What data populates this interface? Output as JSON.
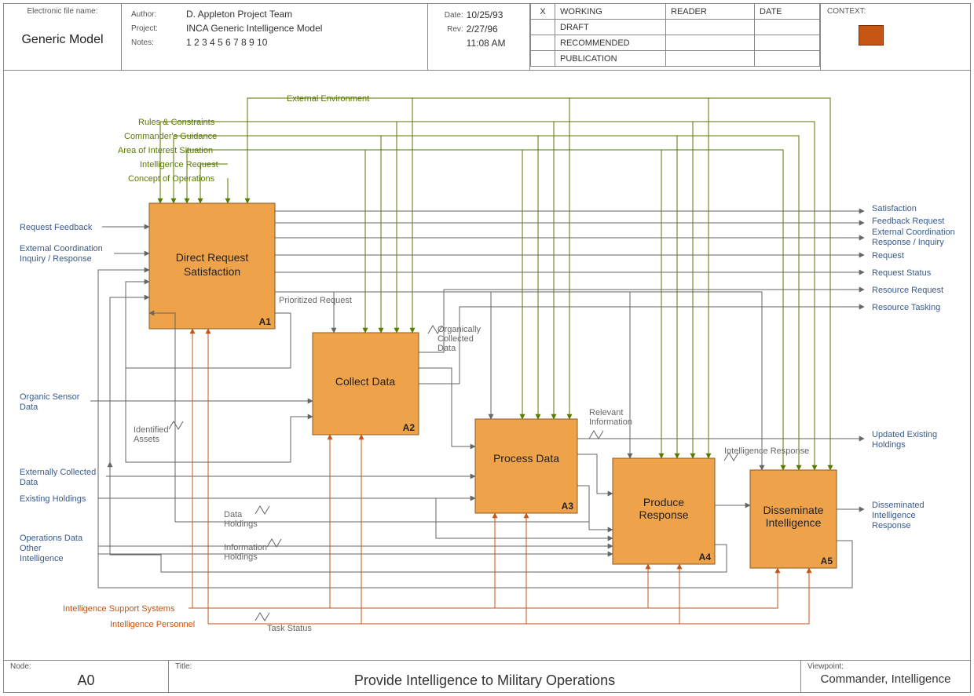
{
  "header": {
    "efname_lbl": "Electronic file name:",
    "efname": "Generic Model",
    "author_lbl": "Author:",
    "author": "D. Appleton Project Team",
    "project_lbl": "Project:",
    "project": "INCA Generic Intelligence Model",
    "notes_lbl": "Notes:",
    "notes": "1  2  3  4  5  6  7  8  9  10",
    "date_lbl": "Date:",
    "date": "10/25/93",
    "rev_lbl": "Rev:",
    "rev": "2/27/96",
    "rev_time": "11:08 AM",
    "status_x": "X",
    "status_rows": [
      "WORKING",
      "DRAFT",
      "RECOMMENDED",
      "PUBLICATION"
    ],
    "reader_lbl": "READER",
    "rdate_lbl": "DATE",
    "context_lbl": "CONTEXT:"
  },
  "footer": {
    "node_lbl": "Node:",
    "node": "A0",
    "title_lbl": "Title:",
    "title": "Provide Intelligence to Military Operations",
    "vp_lbl": "Viewpoint:",
    "vp": "Commander, Intelligence"
  },
  "activities": {
    "a1": {
      "name_l1": "Direct Request",
      "name_l2": "Satisfaction",
      "id": "A1"
    },
    "a2": {
      "name_l1": "Collect Data",
      "name_l2": "",
      "id": "A2"
    },
    "a3": {
      "name_l1": "Process Data",
      "name_l2": "",
      "id": "A3"
    },
    "a4": {
      "name_l1": "Produce",
      "name_l2": "Response",
      "id": "A4"
    },
    "a5": {
      "name_l1": "Disseminate",
      "name_l2": "Intelligence",
      "id": "A5"
    }
  },
  "controls": {
    "ext_env": "External Environment",
    "rules": "Rules & Constraints",
    "guidance": "Commander's Guidance",
    "aoi": "Area of Interest Situation",
    "intreq": "Intelligence Request",
    "conops": "Concept of Operations"
  },
  "inputs_left": {
    "reqfb": "Request Feedback",
    "extcoord_l1": "External Coordination",
    "extcoord_l2": "Inquiry / Response",
    "osd_l1": "Organic Sensor",
    "osd_l2": "Data",
    "extcol_l1": "Externally Collected",
    "extcol_l2": "Data",
    "existhold": "Existing Holdings",
    "opdata": "Operations Data",
    "otherint_l1": "Other",
    "otherint_l2": "Intelligence"
  },
  "outputs_right": {
    "sat": "Satisfaction",
    "fbreq": "Feedback Request",
    "extcoord_r1": "External Coordination",
    "extcoord_r2": "Response / Inquiry",
    "req": "Request",
    "reqstat": "Request Status",
    "resreq": "Resource Request",
    "restask": "Resource Tasking",
    "updhold_l1": "Updated Existing",
    "updhold_l2": "Holdings",
    "dissem_l1": "Disseminated",
    "dissem_l2": "Intelligence",
    "dissem_l3": "Response"
  },
  "mechanisms": {
    "iss": "Intelligence Support Systems",
    "ip": "Intelligence Personnel"
  },
  "internal": {
    "prioreq": "Prioritized Request",
    "ocd_l1": "Organically",
    "ocd_l2": "Collected",
    "ocd_l3": "Data",
    "relinfo_l1": "Relevant",
    "relinfo_l2": "Information",
    "intresp": "Intelligence Response",
    "idassets_l1": "Identified",
    "idassets_l2": "Assets",
    "datahold_l1": "Data",
    "datahold_l2": "Holdings",
    "infohold_l1": "Information",
    "infohold_l2": "Holdings",
    "taskstat": "Task Status"
  }
}
